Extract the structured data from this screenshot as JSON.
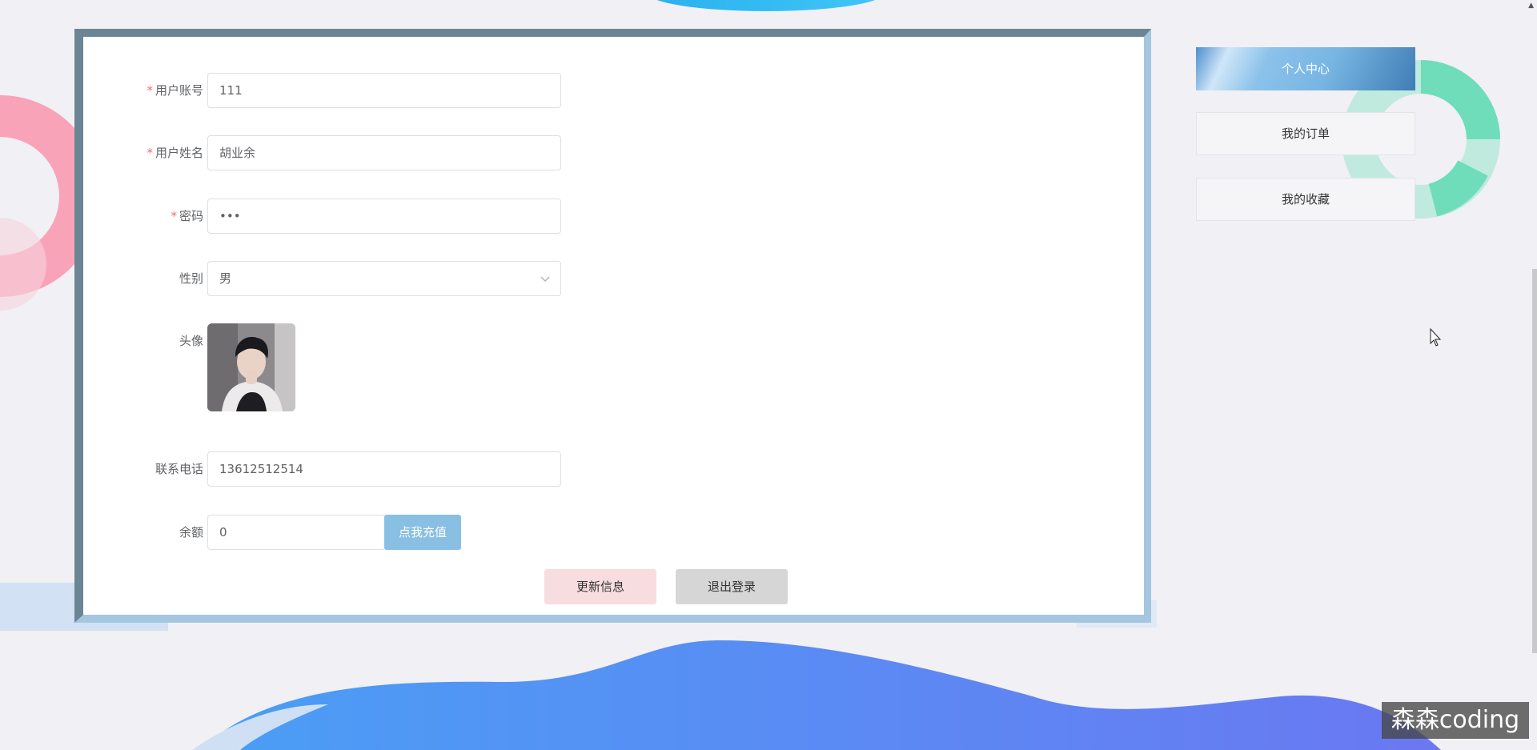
{
  "form": {
    "account": {
      "label": "用户账号",
      "value": "111",
      "required": true
    },
    "name": {
      "label": "用户姓名",
      "value": "胡业余",
      "required": true
    },
    "password": {
      "label": "密码",
      "value": "•••",
      "required": true
    },
    "gender": {
      "label": "性别",
      "value": "男"
    },
    "avatar": {
      "label": "头像"
    },
    "phone": {
      "label": "联系电话",
      "value": "13612512514"
    },
    "balance": {
      "label": "余额",
      "value": "0",
      "recharge_label": "点我充值"
    },
    "required_mark": "*"
  },
  "actions": {
    "update_label": "更新信息",
    "logout_label": "退出登录"
  },
  "side_nav": {
    "items": [
      {
        "label": "个人中心",
        "active": true
      },
      {
        "label": "我的订单",
        "active": false
      },
      {
        "label": "我的收藏",
        "active": false
      }
    ]
  },
  "watermark": "森森coding",
  "colors": {
    "required": "#f56c6c",
    "recharge_button": "#89bfe3",
    "update_button": "#f8dde0",
    "logout_button": "#d6d6d6",
    "card_border_dark": "#6c8594",
    "card_border_light": "#a4c6e0"
  }
}
